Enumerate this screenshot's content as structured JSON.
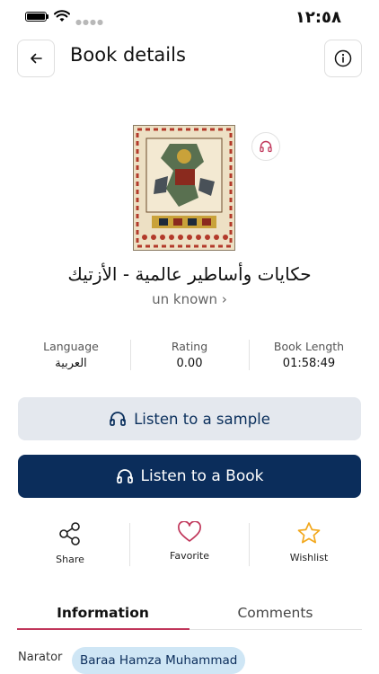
{
  "status_bar": {
    "time": "١٢:٥٨"
  },
  "header": {
    "title": "Book details"
  },
  "book": {
    "title": "حكايات وأساطير عالمية - الأزتيك",
    "author": "un known",
    "author_chevron": "›"
  },
  "stats": [
    {
      "label": "Language",
      "value": "العربية"
    },
    {
      "label": "Rating",
      "value": "0.00"
    },
    {
      "label": "Book Length",
      "value": "01:58:49"
    }
  ],
  "buttons": {
    "sample": "Listen to a sample",
    "book": "Listen to a Book"
  },
  "actions": [
    {
      "label": "Share",
      "icon": "share-icon"
    },
    {
      "label": "Favorite",
      "icon": "heart-icon"
    },
    {
      "label": "Wishlist",
      "icon": "star-icon"
    }
  ],
  "tabs": [
    "Information",
    "Comments"
  ],
  "narrator": {
    "label": "Narator",
    "name": "Baraa Hamza Muhammad"
  },
  "colors": {
    "primary": "#0b2d5b",
    "sample_bg": "#e4e8ee",
    "accent_pink": "#c0365a",
    "star": "#f2a81d",
    "chip_bg": "#cfe6f5"
  }
}
